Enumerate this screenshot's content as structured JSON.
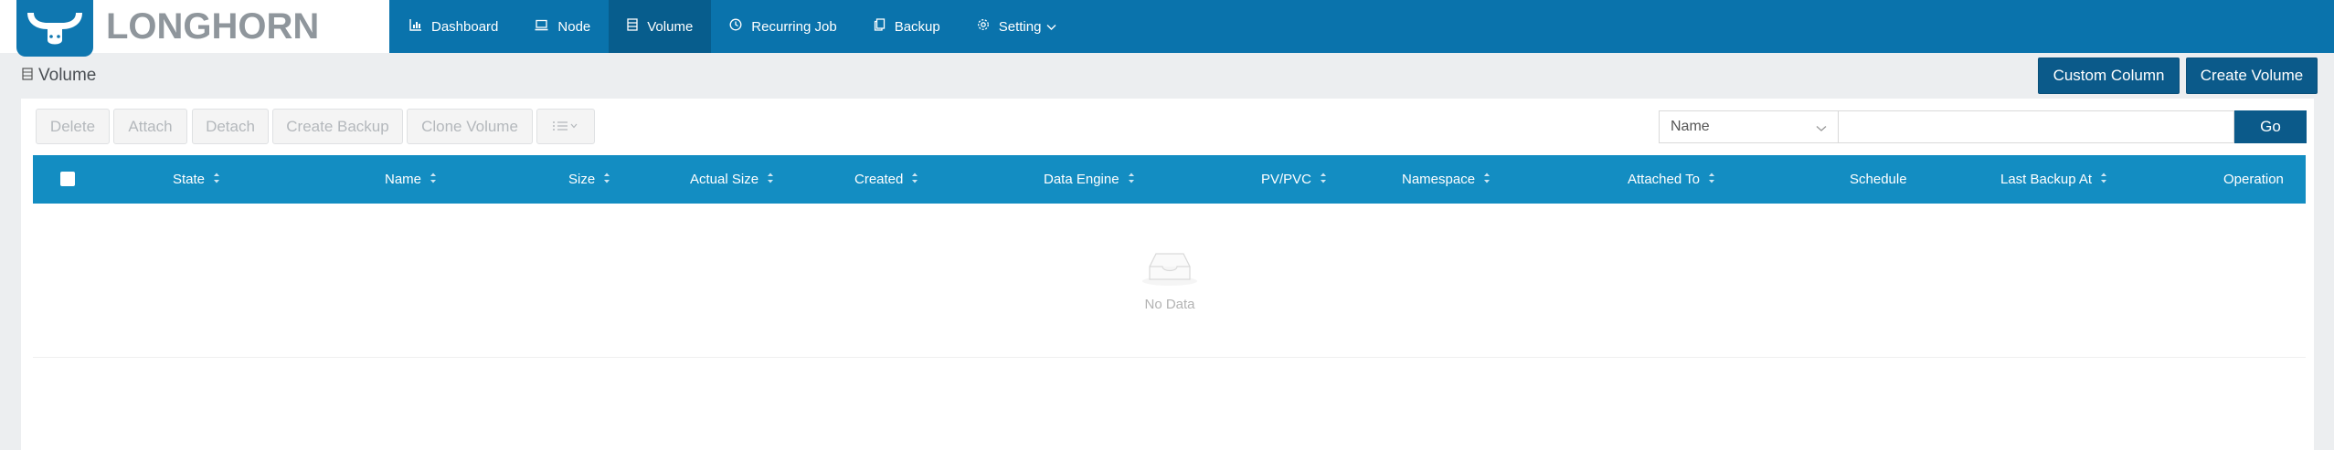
{
  "app": {
    "logo_text": "LONGHORN"
  },
  "nav": {
    "items": [
      {
        "label": "Dashboard",
        "icon": "chart-icon"
      },
      {
        "label": "Node",
        "icon": "laptop-icon"
      },
      {
        "label": "Volume",
        "icon": "database-icon",
        "active": true
      },
      {
        "label": "Recurring Job",
        "icon": "clock-icon"
      },
      {
        "label": "Backup",
        "icon": "copy-icon"
      },
      {
        "label": "Setting",
        "icon": "gear-icon"
      }
    ]
  },
  "page": {
    "title": "Volume"
  },
  "header_buttons": {
    "custom_column": "Custom Column",
    "create_volume": "Create Volume"
  },
  "actions": {
    "delete": "Delete",
    "attach": "Attach",
    "detach": "Detach",
    "create_backup": "Create Backup",
    "clone_volume": "Clone Volume"
  },
  "filter": {
    "field": "Name",
    "value": "",
    "go": "Go"
  },
  "table": {
    "columns": [
      {
        "label": "State",
        "sortable": true
      },
      {
        "label": "Name",
        "sortable": true
      },
      {
        "label": "Size",
        "sortable": true
      },
      {
        "label": "Actual Size",
        "sortable": true
      },
      {
        "label": "Created",
        "sortable": true
      },
      {
        "label": "Data Engine",
        "sortable": true
      },
      {
        "label": "PV/PVC",
        "sortable": true
      },
      {
        "label": "Namespace",
        "sortable": true
      },
      {
        "label": "Attached To",
        "sortable": true
      },
      {
        "label": "Schedule",
        "sortable": false
      },
      {
        "label": "Last Backup At",
        "sortable": true
      },
      {
        "label": "Operation",
        "sortable": false
      }
    ],
    "rows": [],
    "empty_text": "No Data"
  },
  "colors": {
    "topbar": "#0a73ac",
    "nav_active": "#075d8d",
    "table_header": "#138dc2",
    "primary_button": "#0b5a8a"
  }
}
